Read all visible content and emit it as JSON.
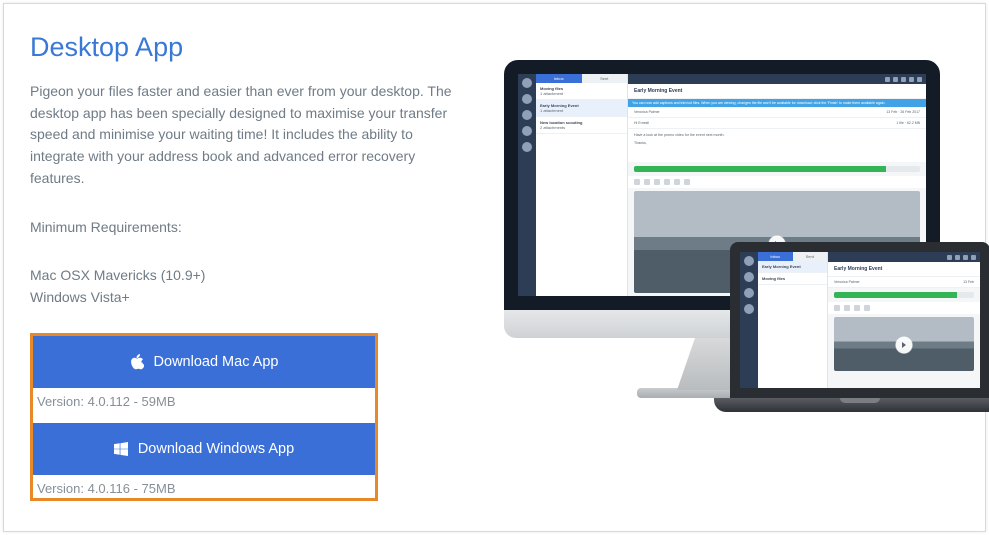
{
  "title": "Desktop App",
  "description": "Pigeon your files faster and easier than ever from your desktop. The desktop app has been specially designed to maximise your transfer speed and minimise your waiting time! It includes the ability to integrate with your address book and advanced error recovery features.",
  "requirements": {
    "label": "Minimum Requirements:",
    "lines": [
      "Mac OSX Mavericks (10.9+)",
      "Windows Vista+"
    ]
  },
  "downloads": {
    "mac": {
      "label": "Download Mac App",
      "version": "Version: 4.0.112 - 59MB"
    },
    "win": {
      "label": "Download Windows App",
      "version": "Version: 4.0.116 - 75MB"
    }
  },
  "screenshot_app": {
    "tabs": [
      "Inbox",
      "Sent"
    ],
    "banner": "You can now add captions and trim/cut files. When you are viewing, changes the file won't be available for download; click the 'Finish' to make them available again.",
    "thread_subject": "Early Morning Event",
    "sender": "Veronica Palmer",
    "to_line": "Hi Ernest!",
    "body_line": "Have a look at the promo video for the event next month.",
    "signoff": "Thanks,",
    "right_meta": [
      "13 Feb",
      "26 Feb 2017",
      "1 file",
      "62.2 MB"
    ],
    "list_items": [
      "Moving files",
      "Early Morning Event",
      "New location scouting"
    ]
  }
}
